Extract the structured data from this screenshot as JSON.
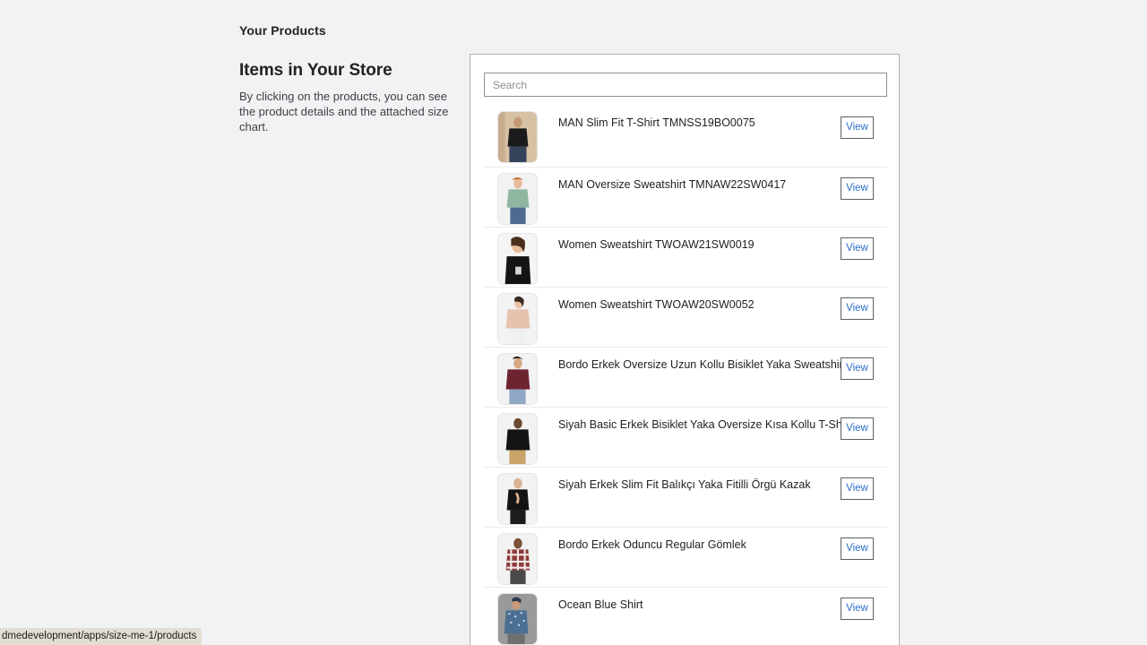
{
  "page": {
    "background_color": "#f1f2f4"
  },
  "left": {
    "eyebrow": "Your Products",
    "title": "Items in Your Store",
    "description": "By clicking on the products, you can see the product details and the attached size chart."
  },
  "search": {
    "placeholder": "Search",
    "value": ""
  },
  "list": {
    "view_label": "View",
    "products": [
      {
        "title": "MAN Slim Fit T-Shirt TMNSS19BO0075",
        "thumb": "man-black-tshirt"
      },
      {
        "title": "MAN Oversize Sweatshirt TMNAW22SW0417",
        "thumb": "man-green-sweatshirt"
      },
      {
        "title": "Women Sweatshirt TWOAW21SW0019",
        "thumb": "woman-black-sweatshirt"
      },
      {
        "title": "Women Sweatshirt TWOAW20SW0052",
        "thumb": "woman-beige-sweatshirt"
      },
      {
        "title": "Bordo Erkek Oversize Uzun Kollu Bisiklet Yaka Sweatshirt",
        "thumb": "man-bordo-sweatshirt"
      },
      {
        "title": "Siyah Basic Erkek Bisiklet Yaka Oversize Kısa Kollu T-Shirt",
        "thumb": "man-black-oversize-tshirt"
      },
      {
        "title": "Siyah Erkek Slim Fit Balıkçı Yaka Fitilli Örgü Kazak",
        "thumb": "man-black-turtleneck"
      },
      {
        "title": "Bordo Erkek Oduncu Regular Gömlek",
        "thumb": "man-plaid-shirt"
      },
      {
        "title": "Ocean Blue Shirt",
        "thumb": "man-blue-shirt"
      }
    ]
  },
  "status_bar": {
    "url": "dmedevelopment/apps/size-me-1/products"
  },
  "colors": {
    "link": "#2c6ecb",
    "text": "#202223",
    "border": "#8c9196",
    "divider": "#ebecef"
  }
}
